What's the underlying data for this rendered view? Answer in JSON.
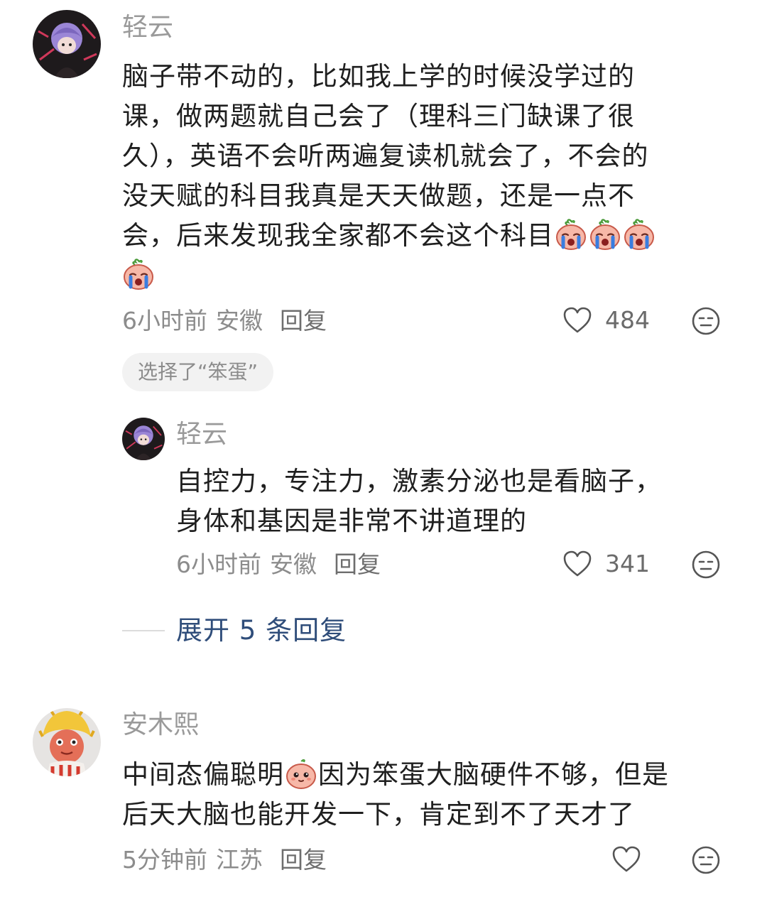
{
  "comments": [
    {
      "user": "轻云",
      "text_lines": [
        "脑子带不动的，比如我上学的时候没学过的",
        "课，做两题就自己会了（理科三门缺课了很",
        "久），英语不会听两遍复读机就会了，不会的",
        "没天赋的科目我真是天天做题，还是一点不",
        "会，后来发现我全家都不会这个科目"
      ],
      "emoji": "crying-face-emoji",
      "time": "6小时前",
      "location": "安徽",
      "reply": "回复",
      "likes": "484",
      "chip": "选择了“笨蛋”"
    },
    {
      "user": "轻云",
      "text_lines": [
        "自控力，专注力，激素分泌也是看脑子，",
        "身体和基因是非常不讲道理的"
      ],
      "time": "6小时前",
      "location": "安徽",
      "reply": "回复",
      "likes": "341"
    },
    {
      "user": "安木熙",
      "text_lines_a": "中间态偏聪明",
      "text_lines_b": "因为笨蛋大脑硬件不够，但是",
      "text_line2": "后天大脑也能开发一下，肯定到不了天才了",
      "emoji": "peach-face-emoji",
      "time": "5分钟前",
      "location": "江苏",
      "reply": "回复"
    }
  ],
  "expand": {
    "label": "展开 5 条回复"
  },
  "colors": {
    "accent_link": "#2f4d7a",
    "meta": "#8c8c8c",
    "chip_bg": "#f2f2f2"
  }
}
